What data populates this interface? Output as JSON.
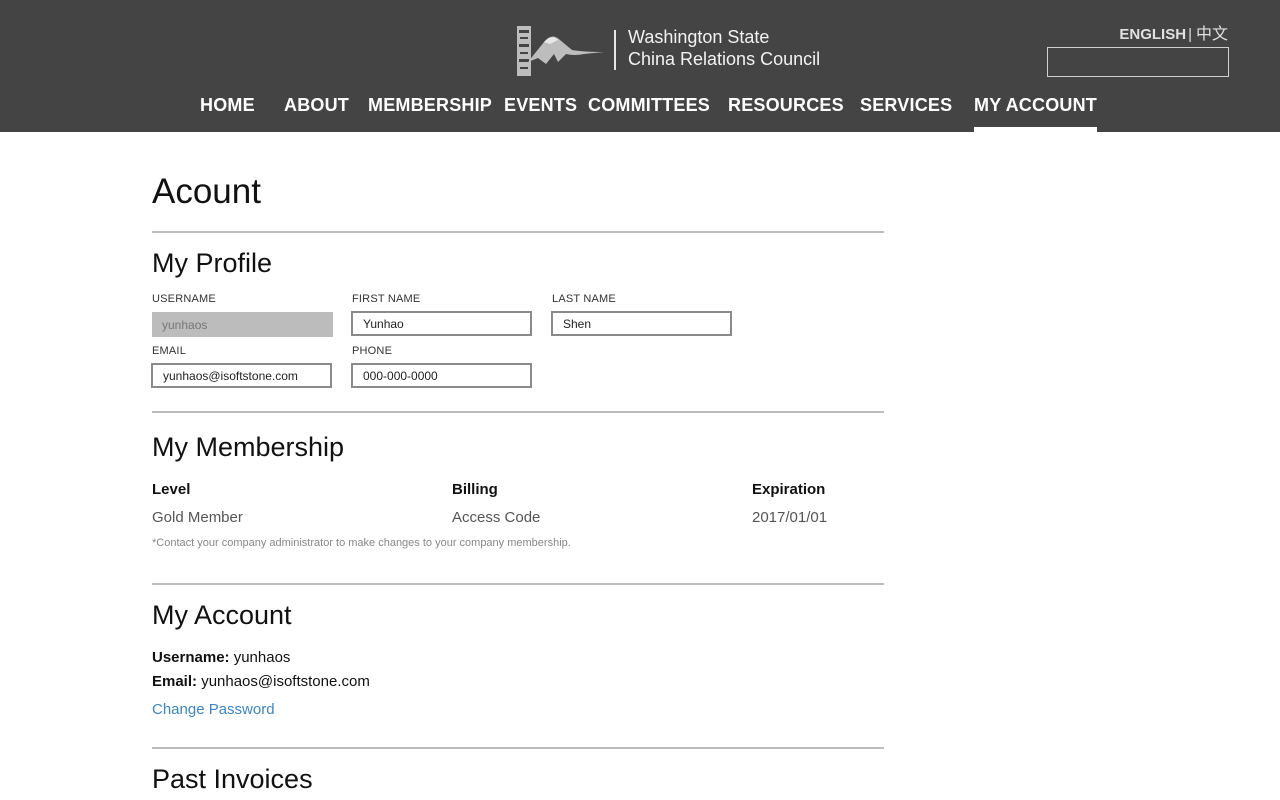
{
  "header": {
    "logo_lines": [
      "Washington State",
      "China Relations Council"
    ],
    "lang_en": "ENGLISH",
    "lang_sep": "|",
    "lang_zh": "中文",
    "search_value": ""
  },
  "nav": {
    "items": [
      "HOME",
      "ABOUT",
      "MEMBERSHIP",
      "EVENTS",
      "COMMITTEES",
      "RESOURCES",
      "SERVICES",
      "MY ACCOUNT"
    ],
    "active": "MY ACCOUNT"
  },
  "page": {
    "title": "Acount"
  },
  "profile": {
    "title": "My Profile",
    "username_label": "USERNAME",
    "username_value": "yunhaos",
    "first_name_label": "FIRST NAME",
    "first_name_value": "Yunhao",
    "last_name_label": "LAST NAME",
    "last_name_value": "Shen",
    "email_label": "EMAIL",
    "email_value": "yunhaos@isoftstone.com",
    "phone_label": "PHONE",
    "phone_value": "000-000-0000"
  },
  "membership": {
    "title": "My Membership",
    "level_label": "Level",
    "level_value": "Gold Member",
    "billing_label": "Billing",
    "billing_value": "Access Code",
    "expiration_label": "Expiration",
    "expiration_value": "2017/01/01",
    "note": "*Contact your company administrator to make changes to your company membership."
  },
  "account": {
    "title": "My Account",
    "username_label": "Username:",
    "username_value": "yunhaos",
    "email_label": "Email:",
    "email_value": "yunhaos@isoftstone.com",
    "change_password": "Change Password"
  },
  "invoices": {
    "title": "Past Invoices"
  },
  "colors": {
    "header_bg": "#444444",
    "link": "#3a86c8",
    "divider": "#bdbdbd"
  }
}
